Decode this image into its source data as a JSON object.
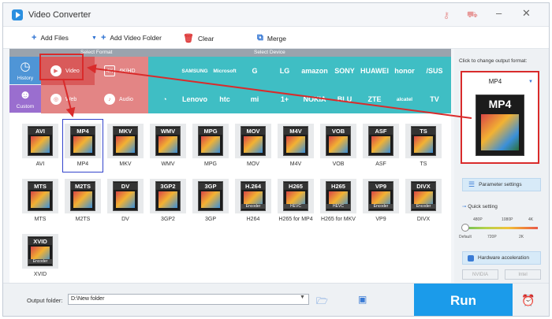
{
  "app": {
    "title": "Video Converter"
  },
  "toolbar": {
    "add_files": "Add Files",
    "add_video_folder": "Add Video Folder",
    "clear": "Clear",
    "merge": "Merge"
  },
  "categories": {
    "select_format": "Select Format",
    "select_device": "Select Device"
  },
  "left": {
    "history": "History",
    "custom": "Custom"
  },
  "format_types": {
    "video": "Video",
    "hd": "4K/HD",
    "web": "Web",
    "audio": "Audio"
  },
  "devices": [
    "",
    "SAMSUNG",
    "Microsoft",
    "G",
    "LG",
    "amazon",
    "SONY",
    "HUAWEI",
    "honor",
    "/SUS",
    "",
    "Lenovo",
    "htc",
    "mi",
    "1+",
    "NOKIA",
    "BLU",
    "ZTE",
    "alcatel",
    "TV"
  ],
  "formats": [
    {
      "name": "AVI",
      "label": "AVI",
      "sub": ""
    },
    {
      "name": "MP4",
      "label": "MP4",
      "sub": ""
    },
    {
      "name": "MKV",
      "label": "MKV",
      "sub": ""
    },
    {
      "name": "WMV",
      "label": "WMV",
      "sub": ""
    },
    {
      "name": "MPG",
      "label": "MPG",
      "sub": ""
    },
    {
      "name": "MOV",
      "label": "MOV",
      "sub": ""
    },
    {
      "name": "M4V",
      "label": "M4V",
      "sub": ""
    },
    {
      "name": "VOB",
      "label": "VOB",
      "sub": ""
    },
    {
      "name": "ASF",
      "label": "ASF",
      "sub": ""
    },
    {
      "name": "TS",
      "label": "TS",
      "sub": ""
    },
    {
      "name": "MTS",
      "label": "MTS",
      "sub": ""
    },
    {
      "name": "M2TS",
      "label": "M2TS",
      "sub": ""
    },
    {
      "name": "DV",
      "label": "DV",
      "sub": ""
    },
    {
      "name": "3GP2",
      "label": "3GP2",
      "sub": ""
    },
    {
      "name": "3GP",
      "label": "3GP",
      "sub": ""
    },
    {
      "name": "H.264",
      "label": "H264",
      "sub": "Encoder"
    },
    {
      "name": "H265",
      "label": "H265 for MP4",
      "sub": "HEVC"
    },
    {
      "name": "H265",
      "label": "H265 for MKV",
      "sub": "HEVC"
    },
    {
      "name": "VP9",
      "label": "VP9",
      "sub": "Encoder"
    },
    {
      "name": "DIVX",
      "label": "DIVX",
      "sub": "Encoder"
    },
    {
      "name": "XVID",
      "label": "XVID",
      "sub": "Encoder"
    }
  ],
  "right": {
    "hint": "Click to change output format:",
    "output_format": "MP4",
    "parameter_settings": "Parameter settings",
    "quick_setting": "Quick setting",
    "quality_top": [
      "480P",
      "1080P",
      "4K"
    ],
    "quality_bottom": [
      "Default",
      "720P",
      "2K"
    ],
    "hardware_acceleration": "Hardware acceleration",
    "gpu": [
      "NVIDIA",
      "Intel"
    ]
  },
  "bottom": {
    "output_folder_label": "Output folder:",
    "output_folder_value": "D:\\New folder",
    "run": "Run"
  },
  "colors": {
    "accent": "#1b9bea",
    "format_red": "#e38585",
    "device_teal": "#3fbec4",
    "highlight": "#d92b2b"
  }
}
